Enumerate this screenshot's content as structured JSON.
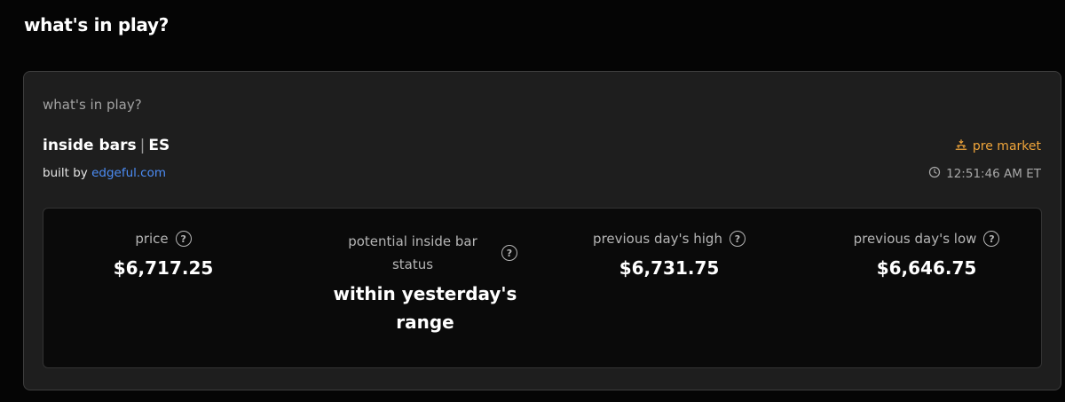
{
  "page_title": "what's in play?",
  "card": {
    "subtitle": "what's in play?",
    "heading_main": "inside bars",
    "heading_sep": "|",
    "heading_symbol": "ES",
    "built_by_prefix": "built by",
    "built_by_link": "edgeful.com",
    "status_label": "pre market",
    "time": "12:51:46 AM ET"
  },
  "metrics": [
    {
      "label": "price",
      "value": "$6,717.25"
    },
    {
      "label": "potential inside bar status",
      "value": "within yesterday's range"
    },
    {
      "label": "previous day's high",
      "value": "$6,731.75"
    },
    {
      "label": "previous day's low",
      "value": "$6,646.75"
    }
  ],
  "help_glyph": "?",
  "colors": {
    "background": "#050505",
    "card": "#1e1e1e",
    "panel": "#0a0a0a",
    "accent_orange": "#f0a53a",
    "link_blue": "#4c8df6"
  },
  "icons": [
    "help-icon",
    "sunrise-icon",
    "clock-icon"
  ]
}
